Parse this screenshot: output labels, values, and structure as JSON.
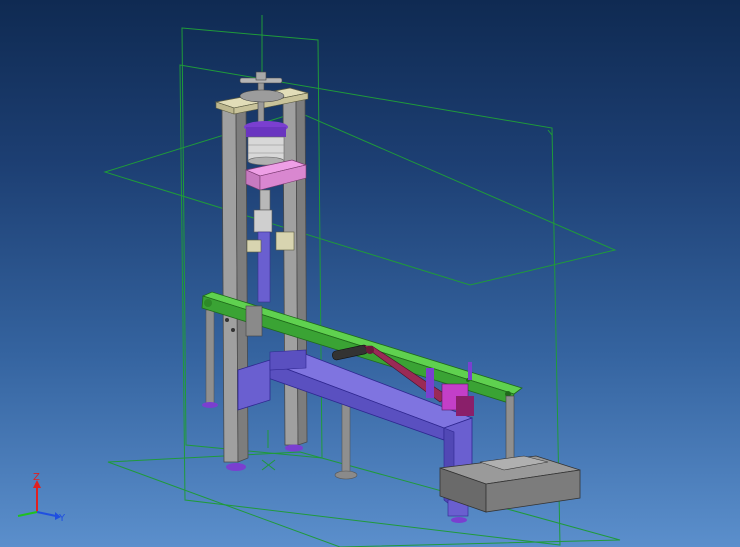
{
  "viewport": {
    "background_top": "#0f2a52",
    "background_bottom": "#5b8fcc",
    "plane_color": "#1f9a3a"
  },
  "colors": {
    "frame_gray": "#9a9a9a",
    "top_plate": "#d8d4b0",
    "lever_green": "#3db33a",
    "support_purple": "#6a5fd0",
    "clamp_pink": "#e08ad8",
    "chuck_purple": "#7a3fd0",
    "handle_maroon": "#8a1f4a",
    "base_dark": "#5a5a5a"
  },
  "triad": {
    "z_label": "Z",
    "y_label": "Y",
    "x_color": "#20c020",
    "y_color": "#2050e0",
    "z_color": "#e02020"
  }
}
